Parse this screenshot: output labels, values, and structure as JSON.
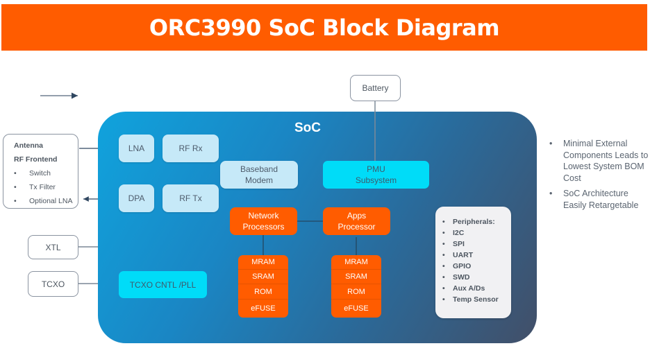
{
  "title": "ORC3990 SoC Block Diagram",
  "soc": {
    "label": "SoC",
    "blocks": {
      "lna": "LNA",
      "rf_rx": "RF Rx",
      "dpa": "DPA",
      "rf_tx": "RF Tx",
      "baseband_modem": "Baseband Modem",
      "pmu_subsystem": "PMU Subsystem",
      "network_processors": "Network Processors",
      "apps_processor": "Apps Processor",
      "tcxo_cntl_pll": "TCXO CNTL /PLL"
    },
    "network_memory": [
      "MRAM",
      "SRAM",
      "ROM",
      "eFUSE"
    ],
    "apps_memory": [
      "MRAM",
      "SRAM",
      "ROM",
      "eFUSE"
    ],
    "peripherals": [
      "Peripherals:",
      "I2C",
      "SPI",
      "UART",
      "GPIO",
      "SWD",
      "Aux A/Ds",
      "Temp Sensor"
    ]
  },
  "external": {
    "battery": "Battery",
    "xtl": "XTL",
    "tcxo": "TCXO",
    "antenna": {
      "headings": [
        "Antenna",
        "RF Frontend"
      ],
      "items": [
        "Switch",
        "Tx Filter",
        "Optional LNA"
      ]
    }
  },
  "notes": [
    "Minimal External Components Leads to Lowest System BOM Cost",
    "SoC Architecture Easily Retargetable"
  ],
  "bullet": "•",
  "colors": {
    "accent_orange": "#ff5c00",
    "cyan": "#00dcf8",
    "light_blue": "#c6e9f8",
    "soc_gradient_start": "#10a3dd",
    "soc_gradient_end": "#424f68"
  }
}
